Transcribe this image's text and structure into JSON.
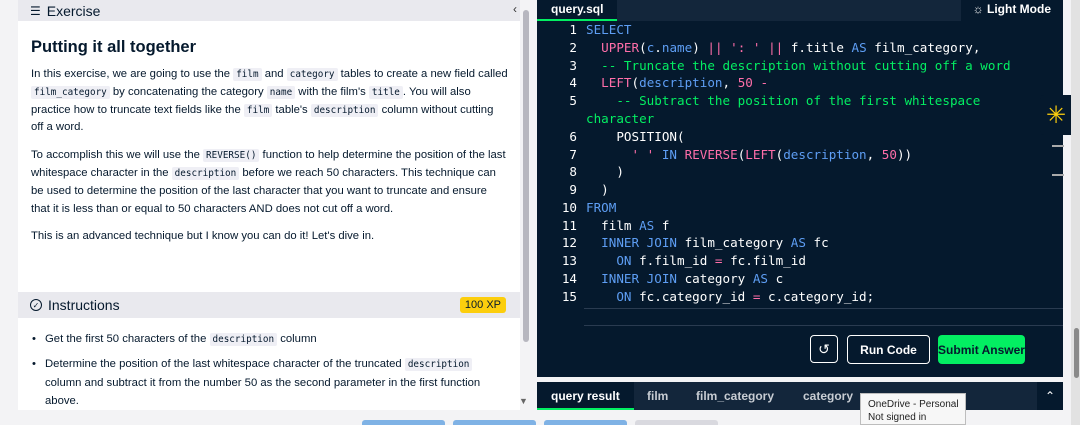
{
  "exercise": {
    "section_label": "Exercise",
    "title": "Putting it all together",
    "para1": {
      "t1": "In this exercise, we are going to use the ",
      "c1": "film",
      "t2": " and ",
      "c2": "category",
      "t3": " tables to create a new field called ",
      "c3": "film_category",
      "t4": " by concatenating the category ",
      "c4": "name",
      "t5": " with the film's ",
      "c5": "title",
      "t6": ". You will also practice how to truncate text fields like the ",
      "c6": "film",
      "t7": " table's ",
      "c7": "description",
      "t8": " column without cutting off a word."
    },
    "para2": {
      "t1": "To accomplish this we will use the ",
      "c1": "REVERSE()",
      "t2": " function to help determine the position of the last whitespace character in the ",
      "c2": "description",
      "t3": " before we reach 50 characters. This technique can be used to determine the position of the last character that you want to truncate and ensure that it is less than or equal to 50 characters AND does not cut off a word."
    },
    "para3": "This is an advanced technique but I know you can do it! Let's dive in."
  },
  "instructions": {
    "label": "Instructions",
    "xp": "100 XP",
    "items": [
      {
        "t1": "Get the first 50 characters of the ",
        "c1": "description",
        "t2": " column"
      },
      {
        "t1": "Determine the position of the last whitespace character of the truncated ",
        "c1": "description",
        "t2": " column and subtract it from the number 50 as the second parameter in the first function above."
      }
    ]
  },
  "editor": {
    "tab": "query.sql",
    "light_mode": "Light Mode",
    "line_numbers": [
      "1",
      "2",
      "3",
      "4",
      "5",
      "6",
      "7",
      "8",
      "9",
      "10",
      "11",
      "12",
      "13",
      "14",
      "15"
    ],
    "buttons": {
      "undo_icon": "undo-icon",
      "run": "Run Code",
      "submit": "Submit Answer"
    }
  },
  "results": {
    "tabs": [
      "query result",
      "film",
      "film_category",
      "category"
    ]
  },
  "tooltip": {
    "line1": "OneDrive - Personal",
    "line2": "Not signed in"
  },
  "colors": {
    "editor_bg": "#05192d",
    "accent_green": "#03ef62",
    "keyword_blue": "#5e9ef4",
    "function_pink": "#ff6ea9",
    "xp_yellow": "#fcce0d"
  }
}
